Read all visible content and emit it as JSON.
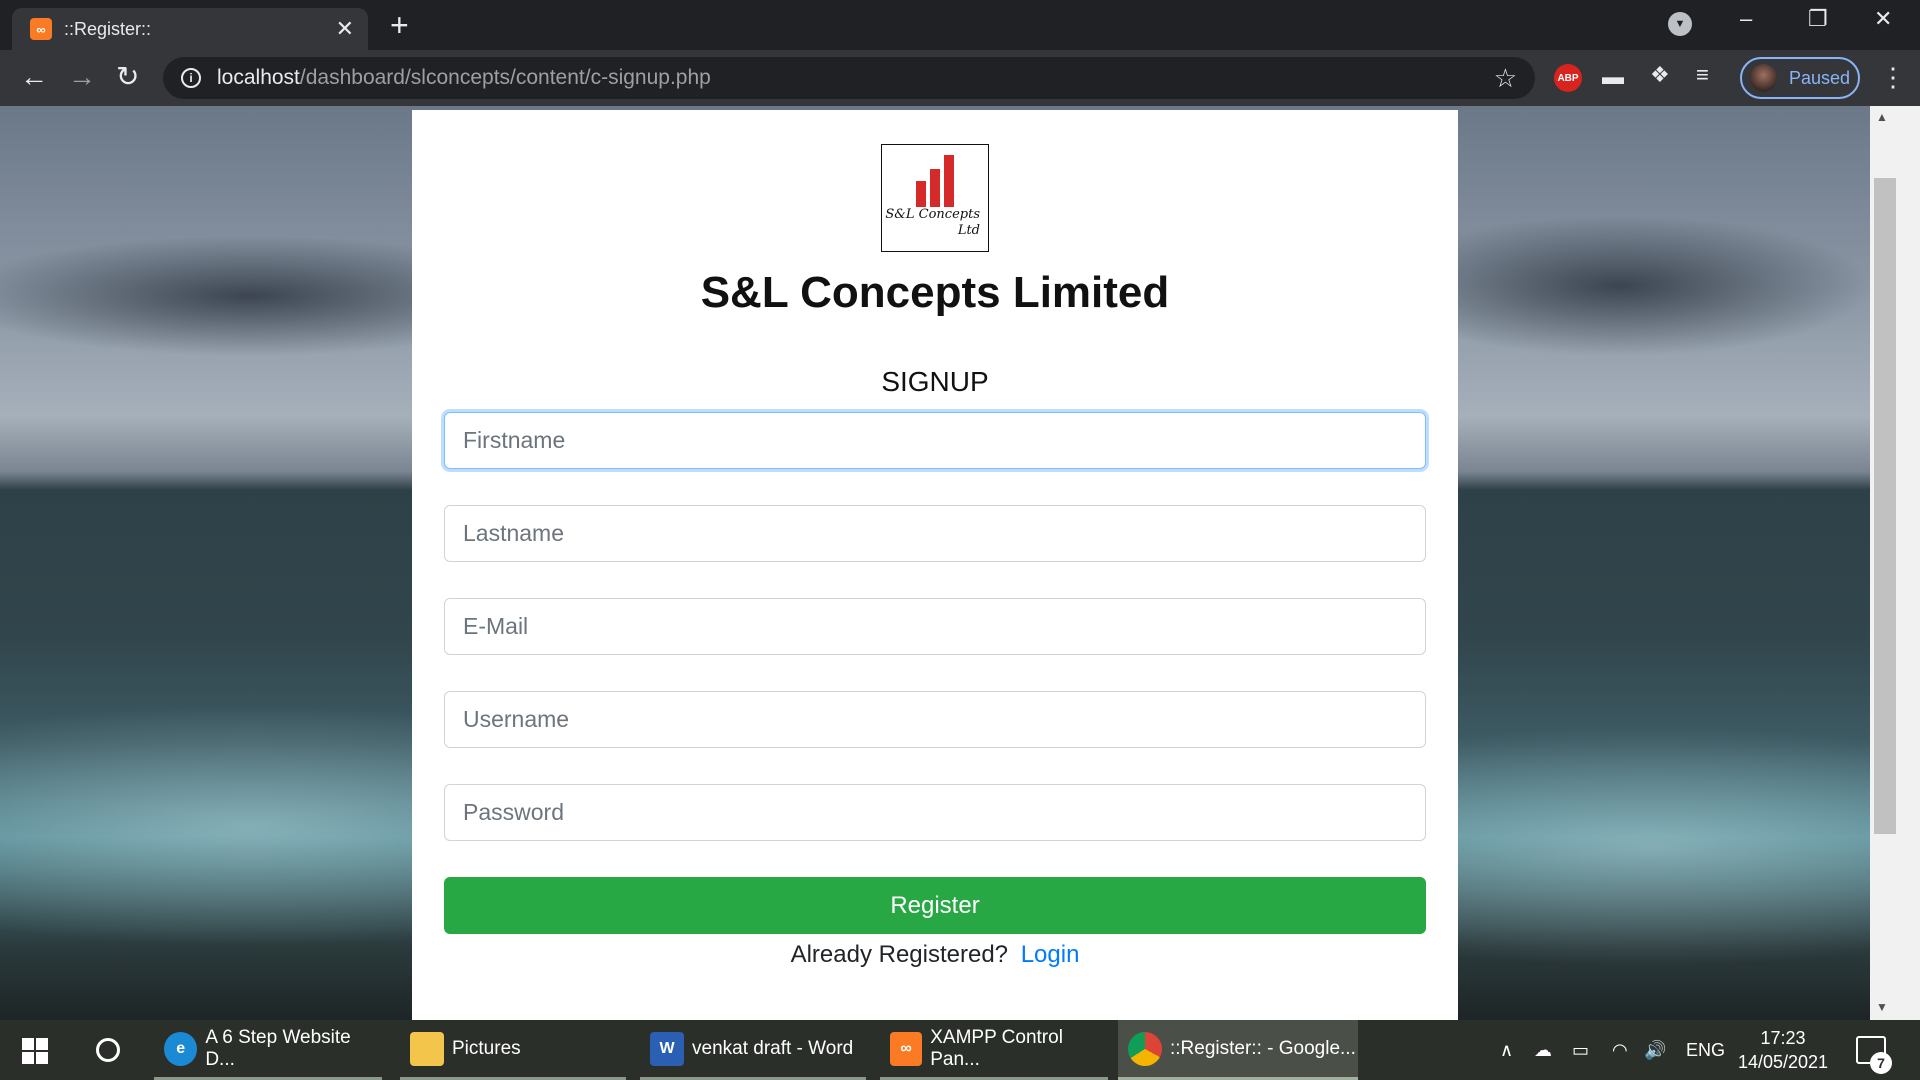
{
  "browser": {
    "tab_title": "::Register::",
    "tab_favicon": "xampp-icon",
    "url_host": "localhost",
    "url_path": "/dashboard/slconcepts/content/c-signup.php",
    "profile_label": "Paused",
    "extensions": [
      "adblock-plus-icon",
      "cast-icon",
      "puzzle-extensions-icon",
      "reading-list-icon"
    ],
    "abp_label": "ABP"
  },
  "page": {
    "logo": {
      "line1": "S&L Concepts",
      "line2": "Ltd"
    },
    "company_name": "S&L Concepts Limited",
    "form_title": "SIGNUP",
    "fields": {
      "firstname_placeholder": "Firstname",
      "lastname_placeholder": "Lastname",
      "email_placeholder": "E-Mail",
      "username_placeholder": "Username",
      "password_placeholder": "Password"
    },
    "register_label": "Register",
    "login_prompt": "Already Registered?",
    "login_link": "Login",
    "colors": {
      "register_button": "#28a745",
      "link": "#007bff",
      "logo_bars": "#d42a2a"
    }
  },
  "taskbar": {
    "tasks": [
      {
        "label": "A 6 Step Website D...",
        "icon": "edge-icon"
      },
      {
        "label": "Pictures",
        "icon": "folder-icon"
      },
      {
        "label": "venkat draft - Word",
        "icon": "word-icon"
      },
      {
        "label": "XAMPP Control Pan...",
        "icon": "xampp-icon"
      },
      {
        "label": "::Register:: - Google...",
        "icon": "chrome-icon"
      }
    ],
    "language": "ENG",
    "time": "17:23",
    "date": "14/05/2021",
    "notification_count": "7"
  }
}
